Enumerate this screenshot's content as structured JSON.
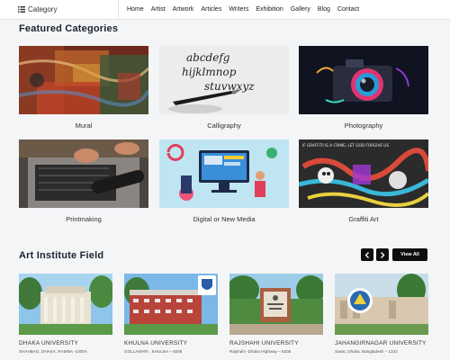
{
  "nav": {
    "category_label": "Category",
    "links": [
      "Home",
      "Artist",
      "Artwork",
      "Articles",
      "Writers",
      "Exhibition",
      "Gallery",
      "Blog",
      "Contact"
    ]
  },
  "featured": {
    "title": "Featured Categories",
    "items": [
      {
        "label": "Mural"
      },
      {
        "label": "Calligraphy"
      },
      {
        "label": "Photography"
      },
      {
        "label": "Printmaking"
      },
      {
        "label": "Digital or New Media"
      },
      {
        "label": "Graffiti Art"
      }
    ]
  },
  "calligraphy_art": {
    "line1": "abcdefg",
    "line2": "hijklmnop",
    "line3": "stuvwxyz"
  },
  "graffiti_art": {
    "top_text": "IF GRAFFITI IS A CRIME, LET GOD FORGIVE US"
  },
  "institutes": {
    "title": "Art Institute Field",
    "view_all": "View All",
    "items": [
      {
        "name": "DHAKA UNIVERSITY",
        "address": "SHAHBAG, DHAKA, RAMNA -1000A"
      },
      {
        "name": "KHULNA UNIVERSITY",
        "address": "GOLLAMARI , KHULNA – 9208"
      },
      {
        "name": "RAJSHAHI UNIVERSITY",
        "address": "Rajshahi -Dhaka Highway – 6205"
      },
      {
        "name": "JAHANGIRNAGAR UNIVERSITY",
        "address": "Savar, Dhaka, Bangladesh – 1342"
      }
    ]
  },
  "colors": {
    "nav_bg": "#ffffff",
    "page_bg": "#f4f5f7",
    "button_bg": "#0e0e0e",
    "heading": "#1d2230"
  }
}
